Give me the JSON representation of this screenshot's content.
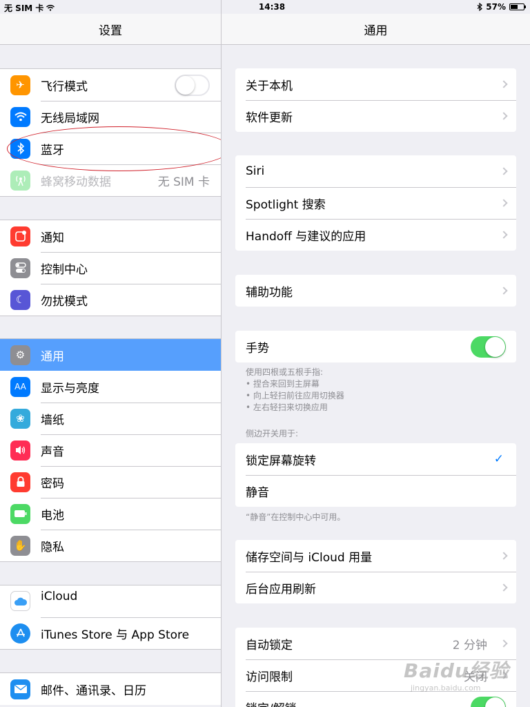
{
  "status_bar": {
    "carrier": "无 SIM 卡",
    "time": "14:38",
    "battery_percent": "57%",
    "battery_level": 0.57
  },
  "master": {
    "title": "设置",
    "groups": [
      {
        "items": [
          {
            "label": "飞行模式",
            "icon": "airplane-icon",
            "color": "#ff9500",
            "toggle": "off"
          },
          {
            "label": "无线局域网",
            "icon": "wifi-icon",
            "color": "#007aff"
          },
          {
            "label": "蓝牙",
            "icon": "bluetooth-icon",
            "color": "#007aff"
          },
          {
            "label": "蜂窝移动数据",
            "icon": "cellular-icon",
            "color": "#4cd964",
            "value": "无 SIM 卡",
            "disabled": true
          }
        ]
      },
      {
        "items": [
          {
            "label": "通知",
            "icon": "notifications-icon",
            "color": "#ff3b30"
          },
          {
            "label": "控制中心",
            "icon": "control-center-icon",
            "color": "#8e8e93"
          },
          {
            "label": "勿扰模式",
            "icon": "moon-icon",
            "color": "#5856d6"
          }
        ]
      },
      {
        "items": [
          {
            "label": "通用",
            "icon": "gear-icon",
            "color": "#8e8e93",
            "selected": true
          },
          {
            "label": "显示与亮度",
            "icon": "display-icon",
            "color": "#007aff",
            "glyph": "AA"
          },
          {
            "label": "墙纸",
            "icon": "wallpaper-icon",
            "color": "#34aadc"
          },
          {
            "label": "声音",
            "icon": "sound-icon",
            "color": "#ff2d55"
          },
          {
            "label": "密码",
            "icon": "lock-icon",
            "color": "#ff3b30"
          },
          {
            "label": "电池",
            "icon": "battery-icon",
            "color": "#4cd964"
          },
          {
            "label": "隐私",
            "icon": "hand-icon",
            "color": "#8e8e93"
          }
        ]
      },
      {
        "items": [
          {
            "label": "iCloud",
            "icon": "icloud-icon",
            "color": "#ffffff"
          },
          {
            "label": "iTunes Store 与 App Store",
            "icon": "app-store-icon",
            "color": "#1d8ef0"
          }
        ]
      },
      {
        "items": [
          {
            "label": "邮件、通讯录、日历",
            "icon": "mail-icon",
            "color": "#1d8ef0"
          }
        ]
      }
    ]
  },
  "detail": {
    "title": "通用",
    "group1": [
      {
        "label": "关于本机"
      },
      {
        "label": "软件更新"
      }
    ],
    "group2": [
      {
        "label": "Siri"
      },
      {
        "label": "Spotlight 搜索"
      },
      {
        "label": "Handoff 与建议的应用"
      }
    ],
    "group3": [
      {
        "label": "辅助功能"
      }
    ],
    "gesture": {
      "label": "手势",
      "toggle": "on"
    },
    "gesture_note": [
      "使用四根或五根手指:",
      "• 捏合来回到主屏幕",
      "• 向上轻扫前往应用切换器",
      "• 左右轻扫来切换应用"
    ],
    "side_switch_header": "侧边开关用于:",
    "side_switch": [
      {
        "label": "锁定屏幕旋转",
        "checked": true
      },
      {
        "label": "静音"
      }
    ],
    "mute_note": "“静音”在控制中心中可用。",
    "group5": [
      {
        "label": "储存空间与 iCloud 用量"
      },
      {
        "label": "后台应用刷新"
      }
    ],
    "group6": [
      {
        "label": "自动锁定",
        "value": "2 分钟"
      },
      {
        "label": "访问限制",
        "value": "关闭"
      },
      {
        "label": "锁定/解锁",
        "toggle": "on"
      }
    ]
  },
  "watermark": {
    "logo": "Baidu经验",
    "sub": "jingyan.baidu.com"
  },
  "colors": {
    "accent": "#007aff",
    "selected_row": "#569ffd",
    "toggle_on": "#4cd964",
    "annotation": "#d0202a"
  }
}
